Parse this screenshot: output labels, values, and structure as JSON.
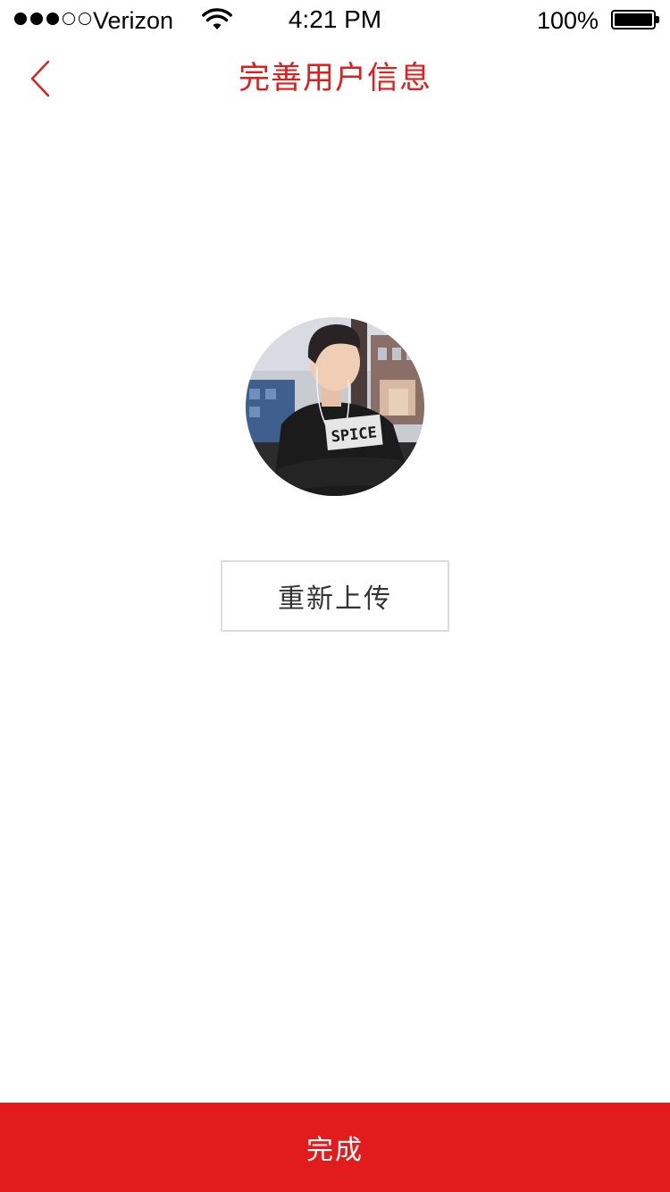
{
  "status_bar": {
    "carrier": "Verizon",
    "signal_bars_filled": 3,
    "signal_bars_total": 5,
    "time": "4:21 PM",
    "battery": "100%",
    "battery_level": 1.0
  },
  "nav": {
    "back_icon": "chevron-left-icon",
    "title": "完善用户信息"
  },
  "avatar": {
    "alt": "user-avatar-photo",
    "shirt_text": "SPICE"
  },
  "actions": {
    "reupload_label": "重新上传",
    "done_label": "完成"
  },
  "colors": {
    "accent": "#e11d1d",
    "button_bg": "#e21c1c",
    "button_border": "#dcdcdc"
  }
}
